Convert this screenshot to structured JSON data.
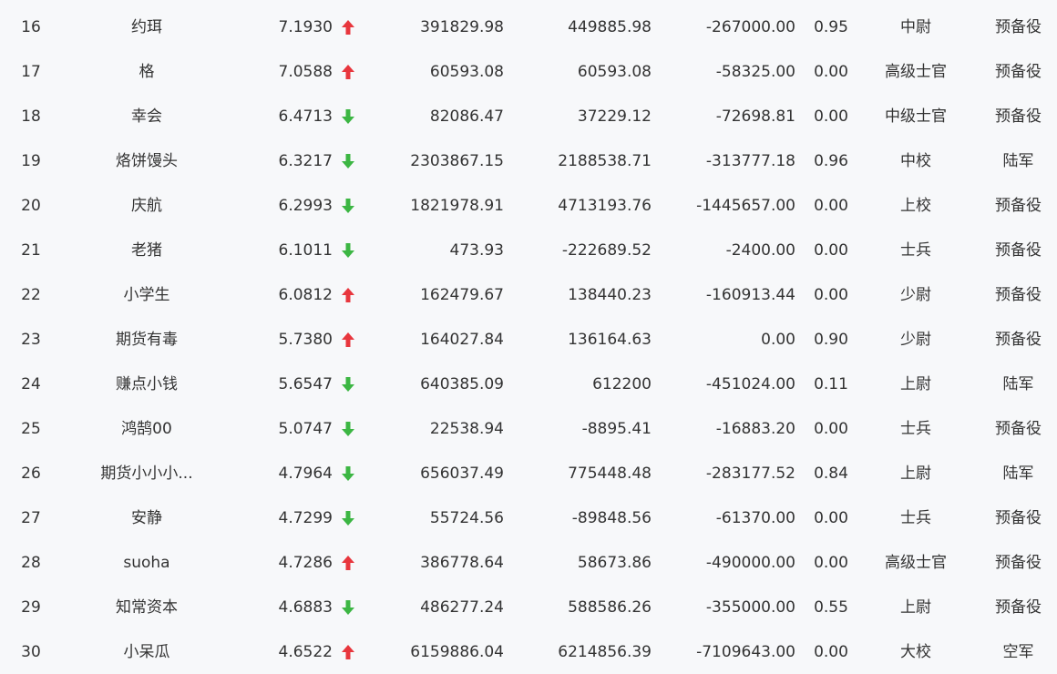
{
  "colors": {
    "up": "#e8363d",
    "down": "#3cb643",
    "text": "#333333",
    "background": "#f7f8fa"
  },
  "rows": [
    {
      "rank": "16",
      "name": "约珥",
      "score": "7.1930",
      "trend": "up",
      "v1": "391829.98",
      "v2": "449885.98",
      "v3": "-267000.00",
      "ratio": "0.95",
      "mil_rank": "中尉",
      "branch": "预备役"
    },
    {
      "rank": "17",
      "name": "格",
      "score": "7.0588",
      "trend": "up",
      "v1": "60593.08",
      "v2": "60593.08",
      "v3": "-58325.00",
      "ratio": "0.00",
      "mil_rank": "高级士官",
      "branch": "预备役"
    },
    {
      "rank": "18",
      "name": "幸会",
      "score": "6.4713",
      "trend": "down",
      "v1": "82086.47",
      "v2": "37229.12",
      "v3": "-72698.81",
      "ratio": "0.00",
      "mil_rank": "中级士官",
      "branch": "预备役"
    },
    {
      "rank": "19",
      "name": "烙饼馒头",
      "score": "6.3217",
      "trend": "down",
      "v1": "2303867.15",
      "v2": "2188538.71",
      "v3": "-313777.18",
      "ratio": "0.96",
      "mil_rank": "中校",
      "branch": "陆军"
    },
    {
      "rank": "20",
      "name": "庆航",
      "score": "6.2993",
      "trend": "down",
      "v1": "1821978.91",
      "v2": "4713193.76",
      "v3": "-1445657.00",
      "ratio": "0.00",
      "mil_rank": "上校",
      "branch": "预备役"
    },
    {
      "rank": "21",
      "name": "老猪",
      "score": "6.1011",
      "trend": "down",
      "v1": "473.93",
      "v2": "-222689.52",
      "v3": "-2400.00",
      "ratio": "0.00",
      "mil_rank": "士兵",
      "branch": "预备役"
    },
    {
      "rank": "22",
      "name": "小学生",
      "score": "6.0812",
      "trend": "up",
      "v1": "162479.67",
      "v2": "138440.23",
      "v3": "-160913.44",
      "ratio": "0.00",
      "mil_rank": "少尉",
      "branch": "预备役"
    },
    {
      "rank": "23",
      "name": "期货有毒",
      "score": "5.7380",
      "trend": "up",
      "v1": "164027.84",
      "v2": "136164.63",
      "v3": "0.00",
      "ratio": "0.90",
      "mil_rank": "少尉",
      "branch": "预备役"
    },
    {
      "rank": "24",
      "name": "赚点小钱",
      "score": "5.6547",
      "trend": "down",
      "v1": "640385.09",
      "v2": "612200",
      "v3": "-451024.00",
      "ratio": "0.11",
      "mil_rank": "上尉",
      "branch": "陆军"
    },
    {
      "rank": "25",
      "name": "鸿鹄00",
      "score": "5.0747",
      "trend": "down",
      "v1": "22538.94",
      "v2": "-8895.41",
      "v3": "-16883.20",
      "ratio": "0.00",
      "mil_rank": "士兵",
      "branch": "预备役"
    },
    {
      "rank": "26",
      "name": "期货小小小...",
      "score": "4.7964",
      "trend": "down",
      "v1": "656037.49",
      "v2": "775448.48",
      "v3": "-283177.52",
      "ratio": "0.84",
      "mil_rank": "上尉",
      "branch": "陆军"
    },
    {
      "rank": "27",
      "name": "安静",
      "score": "4.7299",
      "trend": "down",
      "v1": "55724.56",
      "v2": "-89848.56",
      "v3": "-61370.00",
      "ratio": "0.00",
      "mil_rank": "士兵",
      "branch": "预备役"
    },
    {
      "rank": "28",
      "name": "suoha",
      "score": "4.7286",
      "trend": "up",
      "v1": "386778.64",
      "v2": "58673.86",
      "v3": "-490000.00",
      "ratio": "0.00",
      "mil_rank": "高级士官",
      "branch": "预备役"
    },
    {
      "rank": "29",
      "name": "知常资本",
      "score": "4.6883",
      "trend": "down",
      "v1": "486277.24",
      "v2": "588586.26",
      "v3": "-355000.00",
      "ratio": "0.55",
      "mil_rank": "上尉",
      "branch": "预备役"
    },
    {
      "rank": "30",
      "name": "小呆瓜",
      "score": "4.6522",
      "trend": "up",
      "v1": "6159886.04",
      "v2": "6214856.39",
      "v3": "-7109643.00",
      "ratio": "0.00",
      "mil_rank": "大校",
      "branch": "空军"
    }
  ]
}
